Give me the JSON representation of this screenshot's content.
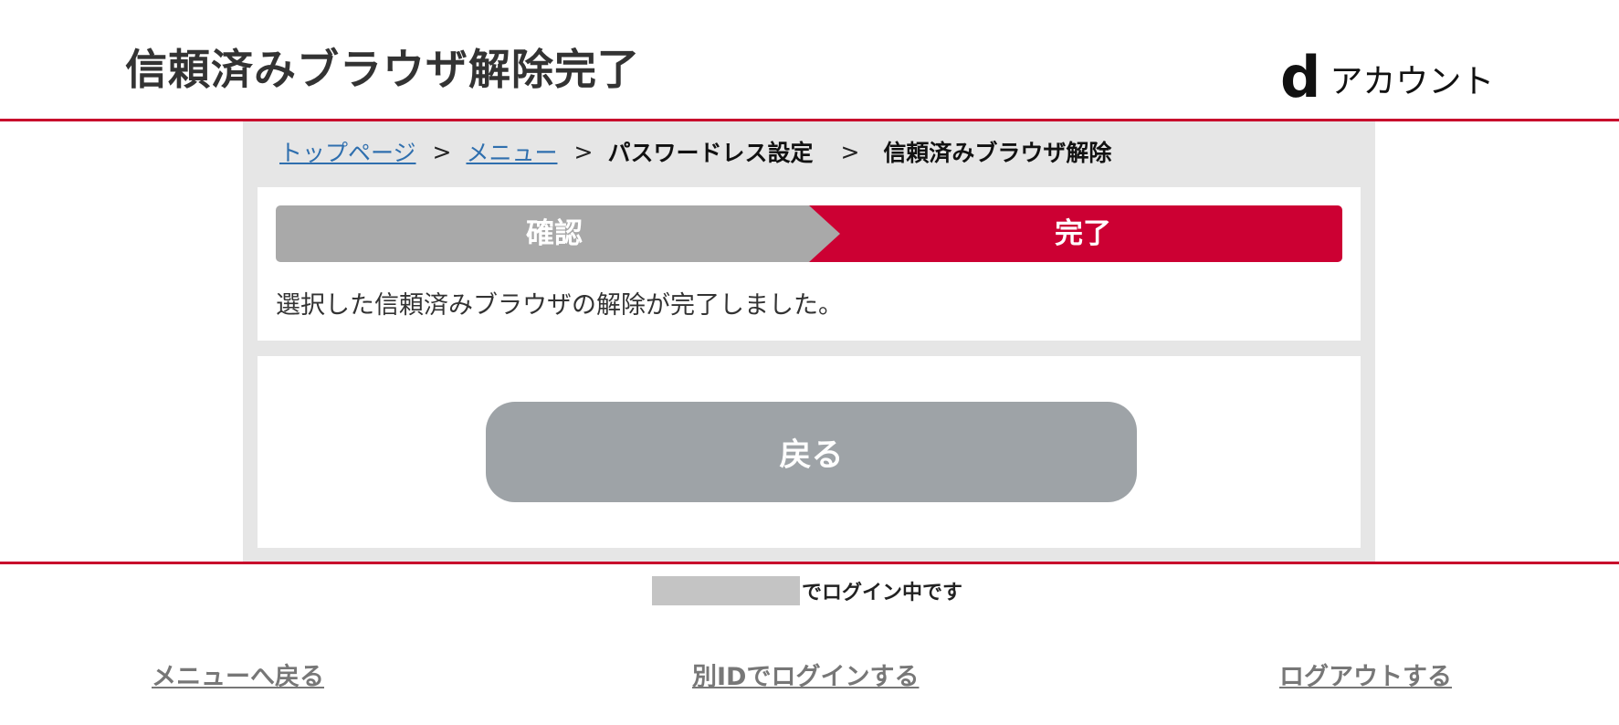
{
  "header": {
    "title": "信頼済みブラウザ解除完了",
    "logo": {
      "mark": "d",
      "text": "アカウント"
    }
  },
  "breadcrumb": {
    "items": [
      {
        "label": "トップページ",
        "link": true
      },
      {
        "label": "メニュー",
        "link": true
      },
      {
        "label": "パスワードレス設定",
        "link": false
      },
      {
        "label": "信頼済みブラウザ解除",
        "link": false
      }
    ],
    "separator": ">"
  },
  "steps": [
    {
      "label": "確認",
      "state": "done"
    },
    {
      "label": "完了",
      "state": "current"
    }
  ],
  "message": "選択した信頼済みブラウザの解除が完了しました。",
  "back_button": {
    "label": "戻る"
  },
  "login_status": {
    "text": "でログイン中です"
  },
  "footer_links": [
    {
      "label": "メニューへ戻る"
    },
    {
      "label": "別IDでログインする"
    },
    {
      "label": "ログアウトする"
    }
  ],
  "colors": {
    "accent": "#cc0033",
    "step_done": "#a9a9a9",
    "button": "#9ea3a7",
    "link": "#2f6fae"
  }
}
